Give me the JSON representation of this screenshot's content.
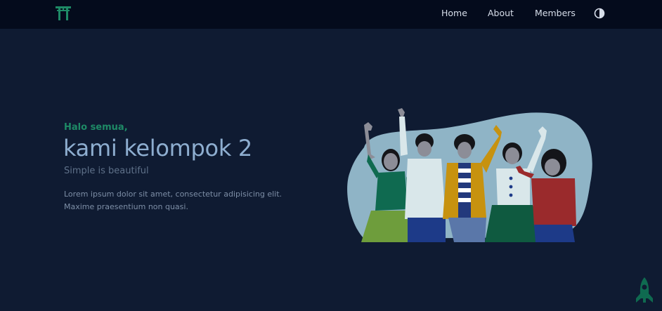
{
  "navbar": {
    "logo_icon": "torii-gate-icon",
    "links": [
      {
        "label": "Home"
      },
      {
        "label": "About"
      },
      {
        "label": "Members"
      }
    ],
    "theme_toggle_icon": "half-circle-contrast-icon"
  },
  "hero": {
    "greeting": "Halo semua,",
    "title": "kami kelompok 2",
    "subtitle": "Simple is beautiful",
    "description": "Lorem ipsum dolor sit amet, consectetur adipisicing elit. Maxime praesentium non quasi.",
    "illustration": "group-of-friends-waving-illustration"
  },
  "scroll_top_icon": "rocket-icon",
  "colors": {
    "background": "#0f1b32",
    "navbar": "#040b1c",
    "accent": "#1e8a66",
    "title": "#8eaed0"
  }
}
